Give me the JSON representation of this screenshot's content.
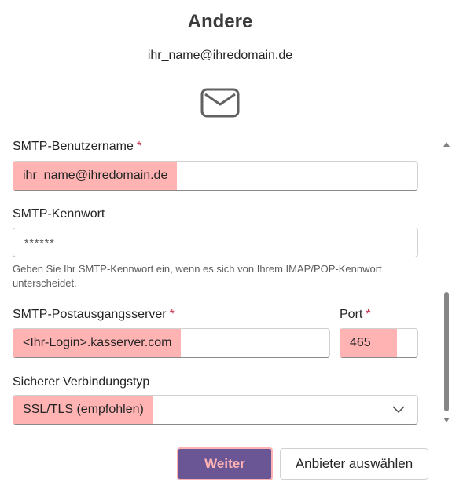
{
  "header": {
    "title": "Andere",
    "email": "ihr_name@ihredomain.de",
    "icon": "envelope-icon"
  },
  "form": {
    "smtp_user": {
      "label": "SMTP-Benutzername",
      "required_mark": "*",
      "value": "ihr_name@ihredomain.de"
    },
    "smtp_password": {
      "label": "SMTP-Kennwort",
      "value": "******",
      "help": "Geben Sie Ihr SMTP-Kennwort ein, wenn es sich von Ihrem IMAP/POP-Kennwort unterscheidet."
    },
    "smtp_server": {
      "label": "SMTP-Postausgangsserver",
      "required_mark": "*",
      "value": "<Ihr-Login>.kasserver.com"
    },
    "port": {
      "label": "Port",
      "required_mark": "*",
      "value": "465"
    },
    "security": {
      "label": "Sicherer Verbindungstyp",
      "value": "SSL/TLS (empfohlen)",
      "icon": "chevron-down-icon"
    }
  },
  "buttons": {
    "next": "Weiter",
    "choose_provider": "Anbieter auswählen"
  },
  "colors": {
    "primary": "#6a5695",
    "highlight": "#ffb3b3",
    "required": "#c4314b"
  }
}
